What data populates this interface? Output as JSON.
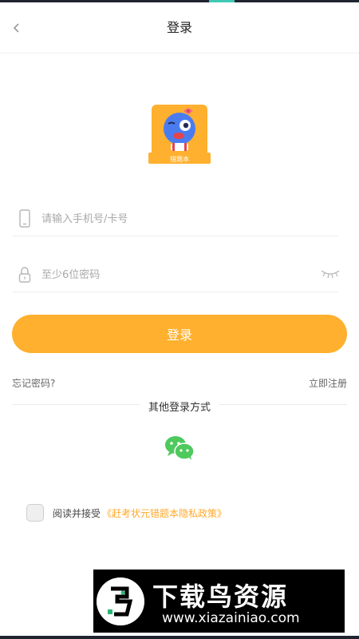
{
  "header": {
    "title": "登录",
    "back_icon": "chevron-left-icon"
  },
  "logo": {
    "caption": "错题本",
    "background_color": "#ffb02e",
    "mascot_color": "#4a7cf0"
  },
  "form": {
    "phone_placeholder": "请输入手机号/卡号",
    "password_placeholder": "至少6位密码",
    "login_button": "登录",
    "forgot_password": "忘记密码?",
    "register": "立即注册"
  },
  "other_login": {
    "label": "其他登录方式",
    "wechat_icon": "wechat-icon",
    "wechat_color": "#4ec95d"
  },
  "agreement": {
    "text": "阅读并接受",
    "policy_link": "《赶考状元错题本隐私政策》",
    "checked": false
  },
  "watermark": {
    "title": "下载鸟资源",
    "url": "www.xiazainiao.com"
  },
  "colors": {
    "accent": "#ffb02e",
    "link": "#ffa928"
  }
}
